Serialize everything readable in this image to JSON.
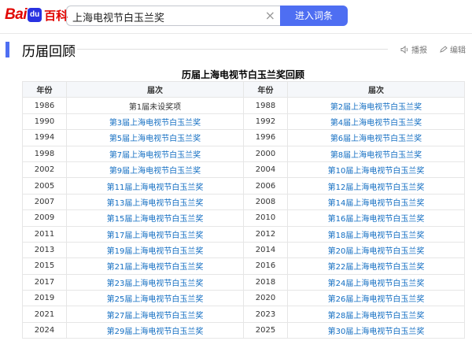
{
  "header": {
    "logo_text": "Bai百科",
    "search_value": "上海电视节白玉兰奖",
    "clear_icon": "×",
    "search_button": "进入词条"
  },
  "section": {
    "title": "历届回顾",
    "play_label": "播报",
    "edit_label": "编辑"
  },
  "table": {
    "caption": "历届上海电视节白玉兰奖回顾",
    "headers": [
      "年份",
      "届次",
      "年份",
      "届次"
    ],
    "rows": [
      [
        "1986",
        "第1届未设奖项",
        "1988",
        "第2届上海电视节白玉兰奖"
      ],
      [
        "1990",
        "第3届上海电视节白玉兰奖",
        "1992",
        "第4届上海电视节白玉兰奖"
      ],
      [
        "1994",
        "第5届上海电视节白玉兰奖",
        "1996",
        "第6届上海电视节白玉兰奖"
      ],
      [
        "1998",
        "第7届上海电视节白玉兰奖",
        "2000",
        "第8届上海电视节白玉兰奖"
      ],
      [
        "2002",
        "第9届上海电视节白玉兰奖",
        "2004",
        "第10届上海电视节白玉兰奖"
      ],
      [
        "2005",
        "第11届上海电视节白玉兰奖",
        "2006",
        "第12届上海电视节白玉兰奖"
      ],
      [
        "2007",
        "第13届上海电视节白玉兰奖",
        "2008",
        "第14届上海电视节白玉兰奖"
      ],
      [
        "2009",
        "第15届上海电视节白玉兰奖",
        "2010",
        "第16届上海电视节白玉兰奖"
      ],
      [
        "2011",
        "第17届上海电视节白玉兰奖",
        "2012",
        "第18届上海电视节白玉兰奖"
      ],
      [
        "2013",
        "第19届上海电视节白玉兰奖",
        "2014",
        "第20届上海电视节白玉兰奖"
      ],
      [
        "2015",
        "第21届上海电视节白玉兰奖",
        "2016",
        "第22届上海电视节白玉兰奖"
      ],
      [
        "2017",
        "第23届上海电视节白玉兰奖",
        "2018",
        "第24届上海电视节白玉兰奖"
      ],
      [
        "2019",
        "第25届上海电视节白玉兰奖",
        "2020",
        "第26届上海电视节白玉兰奖"
      ],
      [
        "2021",
        "第27届上海电视节白玉兰奖",
        "2023",
        "第28届上海电视节白玉兰奖"
      ],
      [
        "2024",
        "第29届上海电视节白玉兰奖",
        "2025",
        "第30届上海电视节白玉兰奖"
      ]
    ]
  },
  "colors": {
    "accent": "#4e6ef2",
    "link": "#136ec2",
    "brand_red": "#e10602"
  }
}
